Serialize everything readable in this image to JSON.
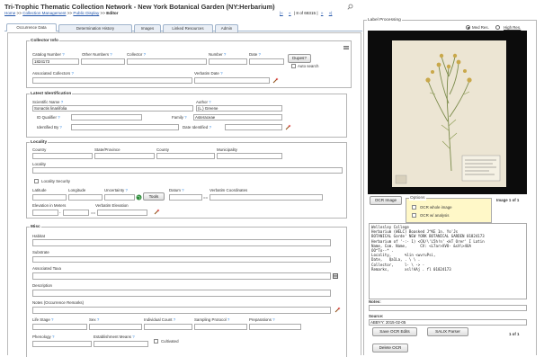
{
  "header": {
    "title": "Tri-Trophic Thematic Collection Network - New York Botanical Garden (NY:Herbarium)",
    "breadcrumb": {
      "home": "Home",
      "sep": ">>",
      "collection_mgmt": "Collection Management",
      "public_display": "Public Display",
      "editor": "Editor"
    },
    "nav": {
      "first": "|«",
      "prev": "«",
      "record_status": "8 of 68315",
      "next": "»",
      "last": "»|",
      "search_icon": "search-icon"
    }
  },
  "tabs": [
    {
      "label": "Occurrence Data",
      "active": true
    },
    {
      "label": "Determination History",
      "active": false
    },
    {
      "label": "Images",
      "active": false
    },
    {
      "label": "Linked Resources",
      "active": false
    },
    {
      "label": "Admin",
      "active": false
    }
  ],
  "collector_info": {
    "legend": "Collector Info",
    "catalog_number_label": "Catalog Number",
    "catalog_number": "1824173",
    "other_numbers_label": "Other Numbers",
    "collector_label": "Collector",
    "number_label": "Number",
    "date_label": "Date",
    "dupes_button": "Dupes?",
    "auto_search_label": "Auto search",
    "associated_collectors_label": "Associated Collectors",
    "verbatim_date_label": "Verbatim Date"
  },
  "latest_identification": {
    "legend": "Latest Identification",
    "scientific_name_label": "Scientific Name",
    "scientific_name": "Sonactis linariifolia",
    "author_label": "Author",
    "author": "(L.) Greene",
    "id_qualifier_label": "ID Qualifier",
    "family_label": "Family",
    "family": "Asteraceae",
    "identified_by_label": "Identified By",
    "date_identified_label": "Date Identified"
  },
  "locality": {
    "legend": "Locality",
    "country_label": "Country",
    "state_label": "State/Province",
    "county_label": "County",
    "municipality_label": "Municipality",
    "locality_label": "Locality",
    "locality_security_label": "Locality Security",
    "latitude_label": "Latitude",
    "longitude_label": "Longitude",
    "uncertainty_label": "Uncertainty",
    "tools_button": "Tools",
    "datum_label": "Datum",
    "verbatim_coords_label": "Verbatim Coordinates",
    "elevation_label": "Elevation in Meters",
    "verbatim_elevation_label": "Verbatim Elevation",
    "equals": "=="
  },
  "misc": {
    "legend": "Misc",
    "habitat_label": "Habitat",
    "substrate_label": "Substrate",
    "associated_taxa_label": "Associated Taxa",
    "description_label": "Description",
    "notes_label": "Notes (Occurrence Remarks)",
    "life_stage_label": "Life Stage",
    "sex_label": "Sex",
    "individual_count_label": "Individual Count",
    "sampling_protocol_label": "Sampling Protocol",
    "preparations_label": "Preparations",
    "phenology_label": "Phenology",
    "establishment_label": "Establishment Means",
    "cultivated_label": "Cultivated"
  },
  "label_processing": {
    "legend": "Label Processing",
    "med_res_label": "Med Res.",
    "high_res_label": "High Res.",
    "ocr_image_button": "OCR Image",
    "options_legend": "Options",
    "ocr_whole_image_label": "OCR whole image",
    "ocr_w_analysis_label": "OCR w/ analysis",
    "image_count": "Image 1 of 1",
    "ocr_text": "Wellesley College\nHerbarium (WELC) Boasked J^KE 1n. Yo'Js\nBOTANICAL Garde' NEW YORK BOTANICAL GARDEN 01824173\nHerbarium of '-:- 1) <CK/\\'L5h!n' <kT Orer' I Latin\nName, Com. Name,      CV: <L7ar>XVO- &sX\\>4UA\nOO^To--* .\nLocality,      %lin <wvruPsi,\nDate,   Qa1La, . \\ \\ .\nCollector,     l- \\ -> -\nRemarks,       xsl!AAj . fl 01824173",
    "notes_label": "Notes:",
    "source_label": "Source:",
    "source_value": "ABBYY: 2015-02-05",
    "save_ocr_button": "Save OCR Edits",
    "salix_button": "SALIX Parser",
    "page_count": "1 of 1",
    "delete_ocr_button": "Delete OCR"
  }
}
